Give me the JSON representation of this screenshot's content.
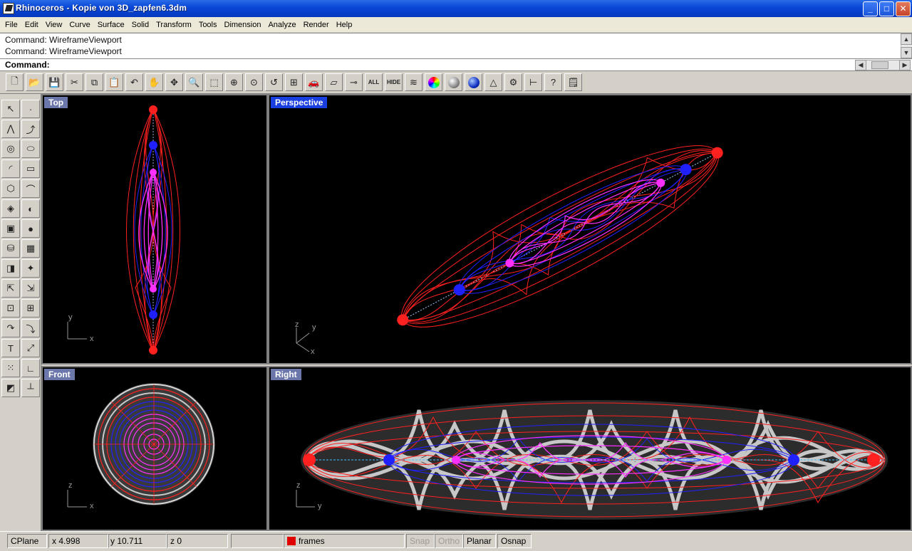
{
  "window": {
    "title": "Rhinoceros - Kopie von 3D_zapfen6.3dm",
    "buttons": {
      "minimize": "_",
      "maximize": "□",
      "close": "✕"
    }
  },
  "menu": [
    "File",
    "Edit",
    "View",
    "Curve",
    "Surface",
    "Solid",
    "Transform",
    "Tools",
    "Dimension",
    "Analyze",
    "Render",
    "Help"
  ],
  "command_history": [
    "Command: WireframeViewport",
    "Command: WireframeViewport"
  ],
  "command_prompt": "Command:",
  "toolbar_text_buttons": {
    "all": "ALL",
    "hide": "HIDE"
  },
  "viewports": {
    "top": {
      "label": "Top",
      "axis_a": "y",
      "axis_b": "x"
    },
    "perspective": {
      "label": "Perspective",
      "axis_a": "y",
      "axis_b": "x",
      "axis_c": "z"
    },
    "front": {
      "label": "Front",
      "axis_a": "z",
      "axis_b": "x"
    },
    "right": {
      "label": "Right",
      "axis_a": "z",
      "axis_b": "y"
    }
  },
  "status": {
    "cplane": "CPlane",
    "x": "x 4.998",
    "y": "y 10.711",
    "z": "z 0",
    "layer": "frames",
    "layer_color": "#e00000",
    "snap": "Snap",
    "ortho": "Ortho",
    "planar": "Planar",
    "osnap": "Osnap"
  },
  "colors": {
    "curve_red": "#ff2020",
    "curve_blue": "#2020ff",
    "curve_magenta": "#ff30ff",
    "axis_cyan": "#40c0ff",
    "tube_white": "#d8d8d8"
  }
}
